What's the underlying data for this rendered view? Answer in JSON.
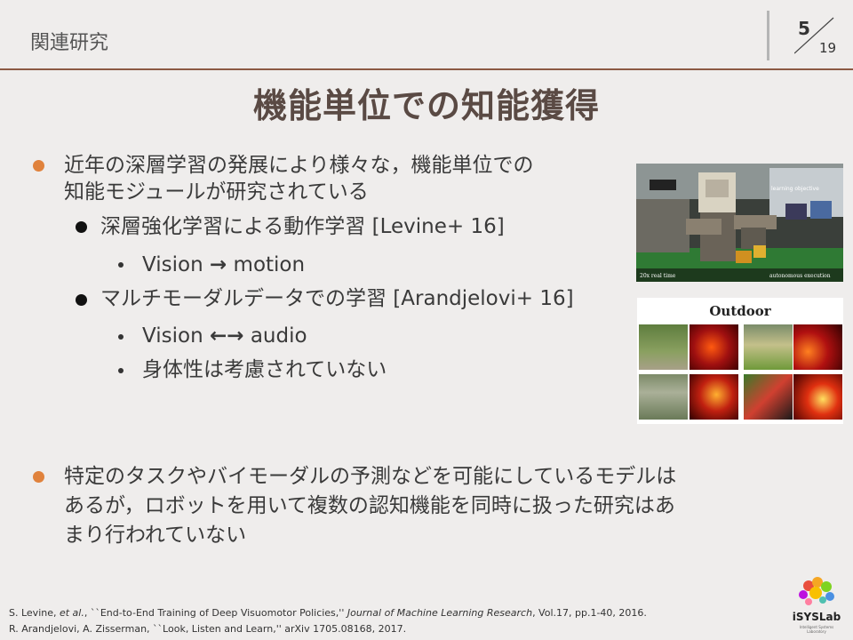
{
  "header": {
    "section_title": "関連研究",
    "page_current": "5",
    "page_total": "19"
  },
  "title": "機能単位での知能獲得",
  "bullets": {
    "b1_line1": "近年の深層学習の発展により様々な，機能単位での",
    "b1_line2": "知能モジュールが研究されている",
    "sub1": "深層強化学習による動作学習 [Levine+ 16]",
    "sub1_item_left": "Vision",
    "sub1_item_arrow": "→",
    "sub1_item_right": "motion",
    "sub2": "マルチモーダルデータでの学習 [Arandjelovi+ 16]",
    "sub2_item1_left": "Vision",
    "sub2_item1_arrow": "←→",
    "sub2_item1_right": "audio",
    "sub2_item2": "身体性は考慮されていない",
    "b2_line1": "特定のタスクやバイモーダルの予測などを可能にしているモデルは",
    "b2_line2": "あるが，ロボットを用いて複数の認知機能を同時に扱った研究はあ",
    "b2_line3": "まり行われていない"
  },
  "images": {
    "robot_caption_top": "learning objective",
    "robot_caption_left": "20x real time",
    "robot_caption_right": "autonomous execution",
    "outdoor_label": "Outdoor"
  },
  "references": {
    "ref1_authors": "S. Levine, ",
    "ref1_etal": "et al.",
    "ref1_title": ", ``End-to-End Training of Deep Visuomotor Policies,'' ",
    "ref1_journal": "Journal of Machine Learning Research",
    "ref1_rest": ", Vol.17, pp.1-40, 2016.",
    "ref2": "R. Arandjelovi, A. Zisserman, ``Look, Listen and Learn,'' arXiv 1705.08168, 2017."
  },
  "logo": {
    "text": "iSYSLab",
    "subtext": "Intelligent Systems Laboratory"
  },
  "colors": {
    "accent_bullet": "#e0823c",
    "rule": "#8c5a44",
    "title": "#5a4a44"
  }
}
